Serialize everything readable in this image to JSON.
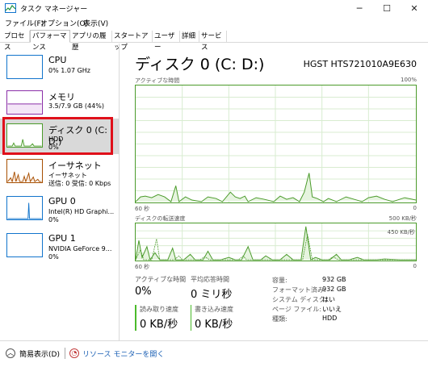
{
  "window": {
    "title": "タスク マネージャー",
    "minimize": "─",
    "maximize": "☐",
    "close": "✕"
  },
  "menu": [
    "ファイル(F)",
    "オプション(O)",
    "表示(V)"
  ],
  "tabs": [
    "プロセス",
    "パフォーマンス",
    "アプリの履歴",
    "スタートアップ",
    "ユーザー",
    "詳細",
    "サービス"
  ],
  "active_tab": "パフォーマンス",
  "sidebar": {
    "items": [
      {
        "name": "CPU",
        "line1": "0% 1.07 GHz",
        "line2": "",
        "color": "#1174cc"
      },
      {
        "name": "メモリ",
        "line1": "3.5/7.9 GB (44%)",
        "line2": "",
        "color": "#8b2fa8"
      },
      {
        "name": "ディスク 0 (C: D:)",
        "line1": "HDD",
        "line2": "0%",
        "color": "#4b9b2b"
      },
      {
        "name": "イーサネット",
        "line1": "イーサネット",
        "line2": "送信: 0 受信: 0 Kbps",
        "color": "#a74f01"
      },
      {
        "name": "GPU 0",
        "line1": "Intel(R) HD Graphi...",
        "line2": "0%",
        "color": "#1174cc"
      },
      {
        "name": "GPU 1",
        "line1": "NVIDIA GeForce 9...",
        "line2": "0%",
        "color": "#1174cc"
      }
    ]
  },
  "main": {
    "title": "ディスク 0 (C: D:)",
    "model": "HGST HTS721010A9E630",
    "graph1": {
      "label": "アクティブな時間",
      "max": "100%",
      "xleft": "60 秒",
      "xright": "0"
    },
    "graph2": {
      "label": "ディスクの転送速度",
      "max": "500 KB/秒",
      "inner": "450 KB/秒",
      "xleft": "60 秒",
      "xright": "0"
    },
    "stats": {
      "active_label": "アクティブな時間",
      "active_value": "0%",
      "response_label": "平均応答時間",
      "response_value": "0 ミリ秒",
      "read_label": "読み取り速度",
      "read_value": "0 KB/秒",
      "write_label": "書き込み速度",
      "write_value": "0 KB/秒"
    },
    "props": [
      {
        "label": "容量:",
        "value": "932 GB"
      },
      {
        "label": "フォーマット済み:",
        "value": "932 GB"
      },
      {
        "label": "システム ディスク:",
        "value": "はい"
      },
      {
        "label": "ページ ファイル:",
        "value": "いいえ"
      },
      {
        "label": "種類:",
        "value": "HDD"
      }
    ]
  },
  "footer": {
    "less_details": "簡易表示(D)",
    "resource_monitor": "リソース モニターを開く"
  }
}
